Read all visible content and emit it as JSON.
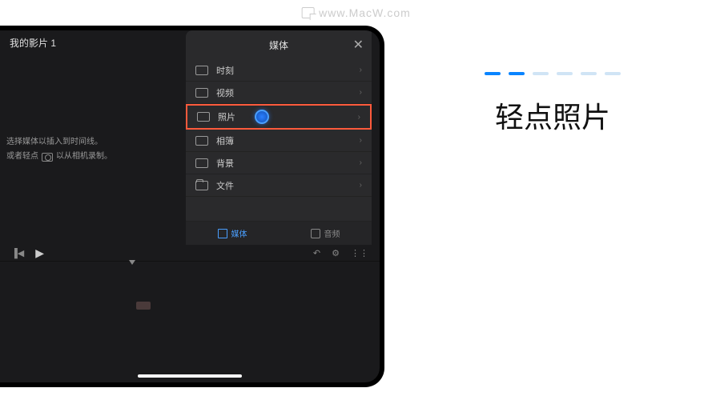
{
  "watermark": "www.MacW.com",
  "project_title": "我的影片 1",
  "hint_line1": "选择媒体以插入到时间线。",
  "hint_line2_prefix": "或者轻点",
  "hint_line2_suffix": "以从相机录制。",
  "panel": {
    "title": "媒体",
    "close": "✕",
    "items": [
      {
        "label": "时刻",
        "highlighted": false
      },
      {
        "label": "视频",
        "highlighted": false
      },
      {
        "label": "照片",
        "highlighted": true
      },
      {
        "label": "相簿",
        "highlighted": false
      },
      {
        "label": "背景",
        "highlighted": false
      },
      {
        "label": "文件",
        "highlighted": false
      }
    ],
    "footer_tabs": [
      {
        "label": "媒体",
        "active": true
      },
      {
        "label": "音频",
        "active": false
      }
    ]
  },
  "instruction": {
    "text": "轻点照片",
    "progress_total": 6,
    "progress_active": 2
  }
}
